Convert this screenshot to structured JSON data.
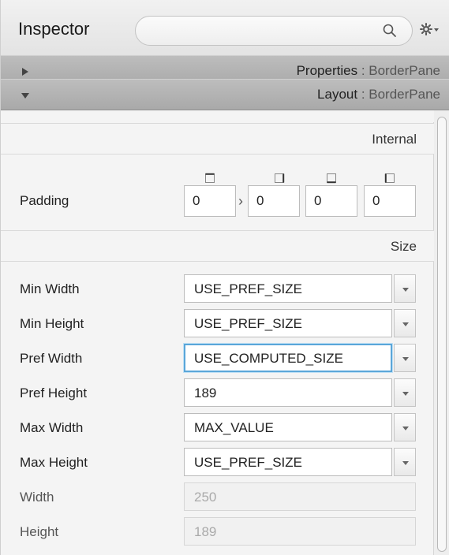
{
  "panel": {
    "title": "Inspector",
    "search": {
      "placeholder": "",
      "value": ""
    }
  },
  "sections": {
    "properties": {
      "label": "Properties",
      "control": "BorderPane",
      "expanded": false
    },
    "layout": {
      "label": "Layout",
      "control": "BorderPane",
      "expanded": true
    }
  },
  "layout": {
    "internal_group": "Internal",
    "size_group": "Size",
    "padding": {
      "label": "Padding",
      "values": [
        "0",
        "0",
        "0",
        "0"
      ]
    },
    "min_width": {
      "label": "Min Width",
      "value": "USE_PREF_SIZE"
    },
    "min_height": {
      "label": "Min Height",
      "value": "USE_PREF_SIZE"
    },
    "pref_width": {
      "label": "Pref Width",
      "value": "USE_COMPUTED_SIZE"
    },
    "pref_height": {
      "label": "Pref Height",
      "value": "189"
    },
    "max_width": {
      "label": "Max Width",
      "value": "MAX_VALUE"
    },
    "max_height": {
      "label": "Max Height",
      "value": "USE_PREF_SIZE"
    },
    "width": {
      "label": "Width",
      "value": "250"
    },
    "height": {
      "label": "Height",
      "value": "189"
    }
  },
  "colors": {
    "focus_ring": "#5aa6d9",
    "section_header": "#b3b3b3"
  }
}
